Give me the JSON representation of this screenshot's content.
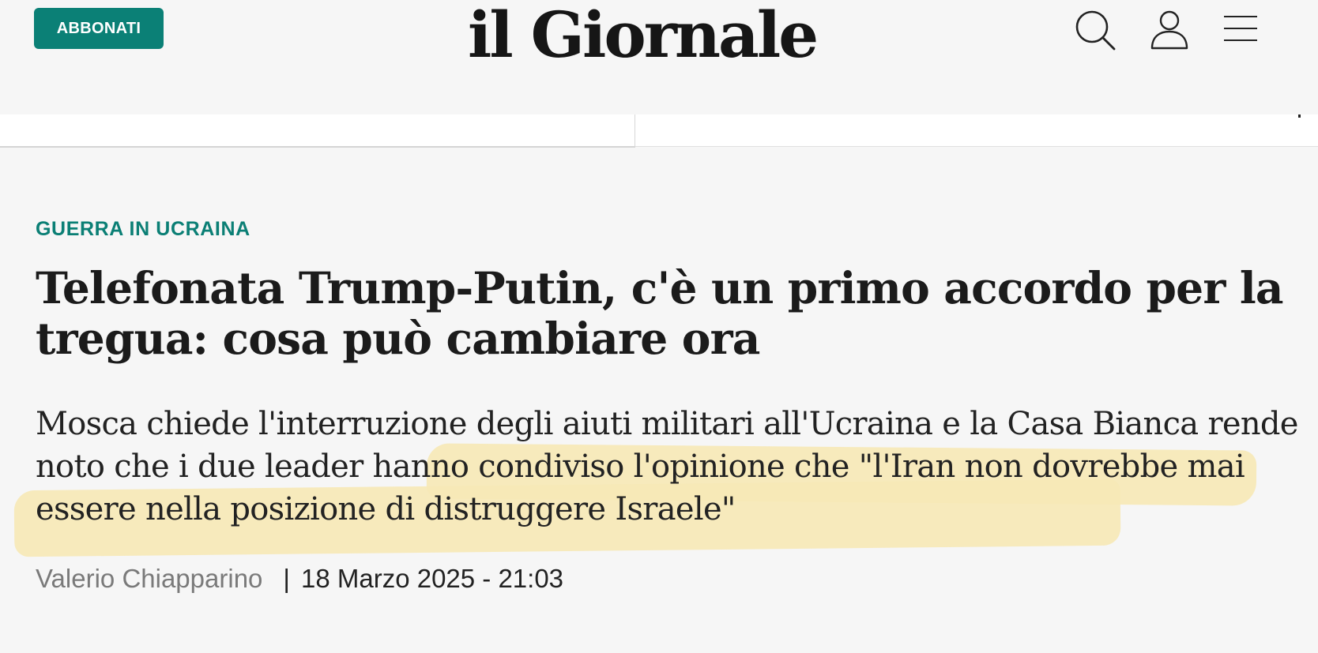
{
  "header": {
    "subscribe_label": "ABBONATI",
    "logo_text": "il Giornale",
    "icons": [
      "search-icon",
      "user-icon",
      "menu-icon"
    ]
  },
  "article": {
    "category": "GUERRA IN UCRAINA",
    "headline": "Telefonata Trump-Putin, c'è un primo accordo per la tregua: cosa può cambiare ora",
    "subtitle": "Mosca chiede l'interruzione degli aiuti militari all'Ucraina e la Casa Bianca rende noto che i due leader hanno condiviso l'opinione che \"l'Iran non dovrebbe mai essere nella posizione di distruggere Israele\"",
    "author": "Valerio Chiapparino",
    "separator": "|",
    "date": "18 Marzo 2025 - 21:03"
  },
  "colors": {
    "accent": "#0b8076",
    "highlight": "#f6e8b6",
    "background": "#f6f6f6"
  }
}
